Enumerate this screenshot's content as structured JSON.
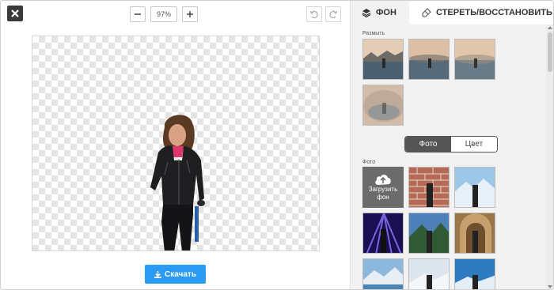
{
  "toolbar": {
    "close_icon": "close-icon",
    "zoom_value": "97%",
    "zoom_out_icon": "minus-icon",
    "zoom_in_icon": "plus-icon",
    "undo_icon": "undo-icon",
    "redo_icon": "redo-icon"
  },
  "download": {
    "label": "Скачать",
    "icon": "download-icon",
    "color": "#2b9af3"
  },
  "panel": {
    "tabs": [
      {
        "label": "ФОН",
        "icon": "layers-icon"
      },
      {
        "label": "СТЕРЕТЬ/ВОССТАНОВИТЬ",
        "icon": "eraser-icon"
      }
    ],
    "blur_label": "Размыть",
    "toggle": {
      "photo": "Фото",
      "color": "Цвет",
      "selected": "Фото"
    },
    "photo_label": "Фото",
    "upload": {
      "line1": "Загрузить",
      "line2": "фон",
      "icon": "cloud-upload-icon"
    }
  }
}
